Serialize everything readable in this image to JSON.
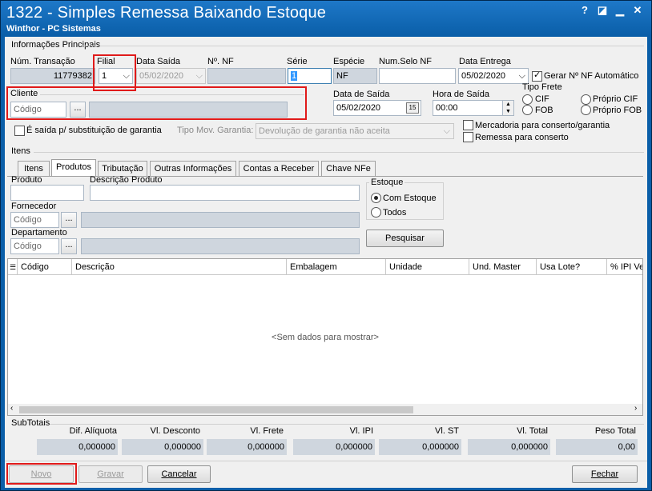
{
  "window": {
    "title": "1322 - Simples Remessa Baixando Estoque",
    "subtitle": "Winthor - PC Sistemas",
    "help_glyph": "?",
    "restore_glyph": "◪",
    "minimize_glyph": "▁",
    "close_glyph": "✕"
  },
  "principal": {
    "section_label": "Informações Principais",
    "num_transacao_label": "Núm. Transação",
    "num_transacao_value": "11779382",
    "filial_label": "Filial",
    "filial_value": "1",
    "data_saida_label": "Data Saída",
    "data_saida_value": "05/02/2020",
    "nf_label": "Nº. NF",
    "nf_value": "",
    "serie_label": "Série",
    "serie_value": "1",
    "especie_label": "Espécie",
    "especie_value": "NF",
    "num_selo_label": "Num.Selo NF",
    "num_selo_value": "",
    "data_entrega_label": "Data Entrega",
    "data_entrega_value": "05/02/2020",
    "gerar_nf_label": "Gerar Nº NF Automático",
    "gerar_nf_checked": true,
    "cliente_label": "Cliente",
    "cliente_placeholder": "Código",
    "cliente_desc": "",
    "dots": "...",
    "data_saida2_label": "Data de Saída",
    "data_saida2_value": "05/02/2020",
    "cal_glyph": "15",
    "hora_saida_label": "Hora de Saída",
    "hora_saida_value": "00:00",
    "tipo_frete_label": "Tipo Frete",
    "frete_cif": "CIF",
    "frete_proprio_cif": "Próprio CIF",
    "frete_fob": "FOB",
    "frete_proprio_fob": "Próprio FOB",
    "saida_garantia_label": "É saída p/ substituição de garantia",
    "tipo_mov_label": "Tipo Mov. Garantia:",
    "tipo_mov_value": "Devolução de garantia não aceita",
    "mercadoria_conserto_label": "Mercadoria para conserto/garantia",
    "remessa_conserto_label": "Remessa para conserto"
  },
  "itens": {
    "section_label": "Itens",
    "tabs": [
      {
        "label": "Itens"
      },
      {
        "label": "Produtos"
      },
      {
        "label": "Tributação"
      },
      {
        "label": "Outras Informações"
      },
      {
        "label": "Contas a Receber"
      },
      {
        "label": "Chave NFe"
      }
    ],
    "produto_label": "Produto",
    "descricao_label": "Descrição Produto",
    "fornecedor_label": "Fornecedor",
    "fornecedor_placeholder": "Código",
    "departamento_label": "Departamento",
    "departamento_placeholder": "Código",
    "estoque_label": "Estoque",
    "com_estoque": "Com Estoque",
    "todos": "Todos",
    "pesquisar": "Pesquisar"
  },
  "grid": {
    "columns": [
      "Código",
      "Descrição",
      "Embalagem",
      "Unidade",
      "Und. Master",
      "Usa Lote?",
      "% IPI Ve"
    ],
    "empty_text": "<Sem dados para mostrar>"
  },
  "subtotais": {
    "section_label": "SubTotais",
    "labels": [
      "Dif. Alíquota",
      "Vl. Desconto",
      "Vl. Frete",
      "Vl. IPI",
      "Vl. ST",
      "Vl. Total",
      "Peso Total"
    ],
    "values": [
      "0,000000",
      "0,000000",
      "0,000000",
      "0,000000",
      "0,000000",
      "0,000000",
      "0,00"
    ]
  },
  "footer": {
    "novo": "Novo",
    "gravar": "Gravar",
    "cancelar": "Cancelar",
    "fechar": "Fechar"
  },
  "colors": {
    "titlebar": "#0a5ea8",
    "highlight": "#e01a1a",
    "readonly_field": "#cfd6de"
  }
}
